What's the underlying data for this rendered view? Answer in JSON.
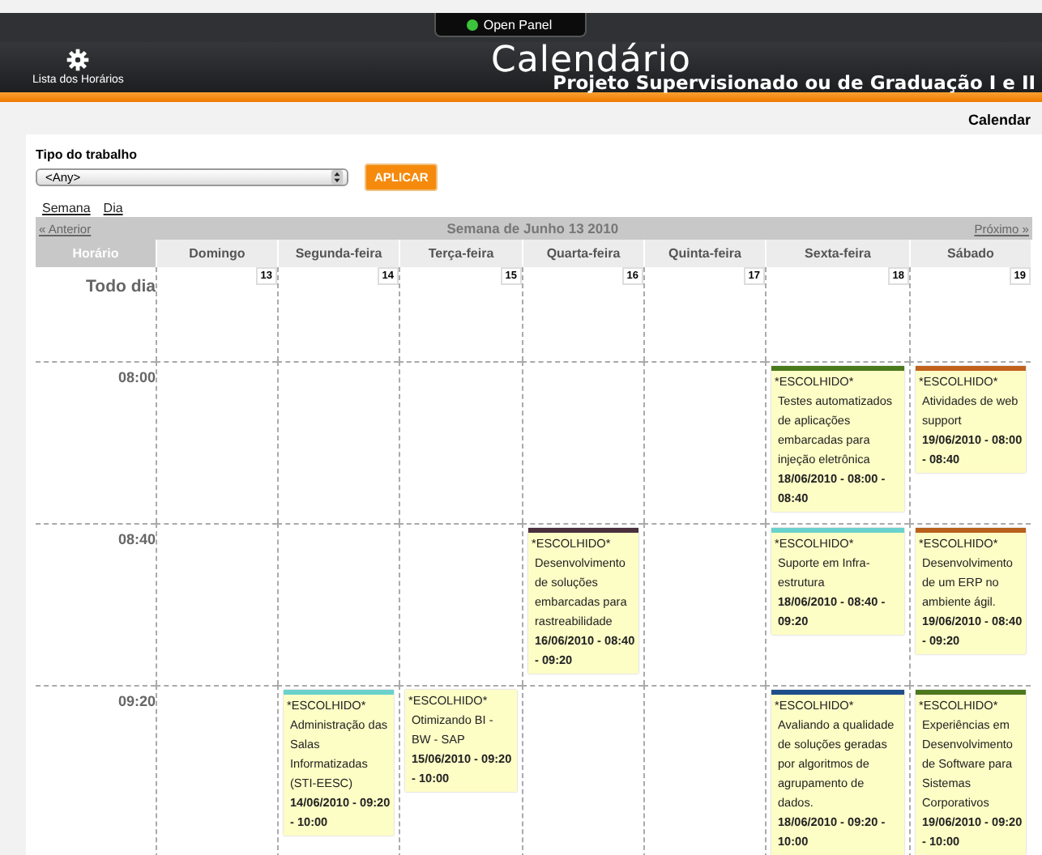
{
  "top_bar": {
    "panel_button": "Open Panel"
  },
  "header": {
    "nav_link": "Lista dos Horários",
    "title": "Calendário",
    "subtitle": "Projeto Supervisionado ou de Graduação I e II"
  },
  "breadcrumb": "Calendar",
  "filter": {
    "label": "Tipo do trabalho",
    "value": "<Any>",
    "button": "APLICAR"
  },
  "views": [
    {
      "label": "Semana"
    },
    {
      "label": "Dia"
    }
  ],
  "week_nav": {
    "previous": "« Anterior",
    "title": "Semana de Junho 13 2010",
    "next": "Próximo »"
  },
  "time_header": "Horário",
  "days": [
    {
      "label": "Domingo",
      "date": "13"
    },
    {
      "label": "Segunda-feira",
      "date": "14"
    },
    {
      "label": "Terça-feira",
      "date": "15"
    },
    {
      "label": "Quarta-feira",
      "date": "16"
    },
    {
      "label": "Quinta-feira",
      "date": "17"
    },
    {
      "label": "Sexta-feira",
      "date": "18"
    },
    {
      "label": "Sábado",
      "date": "19"
    }
  ],
  "all_day_label": "Todo dia",
  "rows": [
    {
      "time": "08:00",
      "cells": [
        {},
        {},
        {},
        {},
        {},
        {
          "tag": "*ESCOLHIDO*",
          "title": "Testes automatizados de aplicações embarcadas para injeção eletrônica",
          "date": "18/06/2010 - 08:00 - 08:40",
          "color": "#4a7a1c"
        },
        {
          "tag": "*ESCOLHIDO*",
          "title": "Atividades de web support",
          "date": "19/06/2010 - 08:00 - 08:40",
          "color": "#c0621c"
        }
      ]
    },
    {
      "time": "08:40",
      "cells": [
        {},
        {},
        {},
        {
          "tag": "*ESCOLHIDO*",
          "title": "Desenvolvimento de soluções embarcadas para rastreabilidade",
          "date": "16/06/2010 - 08:40 - 09:20",
          "color": "#4a2f3c"
        },
        {},
        {
          "tag": "*ESCOLHIDO*",
          "title": "Suporte em Infra-estrutura",
          "date": "18/06/2010 - 08:40 - 09:20",
          "color": "#6ad2cc"
        },
        {
          "tag": "*ESCOLHIDO*",
          "title": "Desenvolvimento de um ERP no ambiente ágil.",
          "date": "19/06/2010 - 08:40 - 09:20",
          "color": "#b8601c"
        }
      ]
    },
    {
      "time": "09:20",
      "cells": [
        {},
        {
          "tag": "*ESCOLHIDO*",
          "title": "Administração das Salas Informatizadas (STI-EESC)",
          "date": "14/06/2010 - 09:20 - 10:00",
          "color": "#6ad2cc"
        },
        {
          "tag": "*ESCOLHIDO*",
          "title": "Otimizando BI - BW - SAP",
          "date": "15/06/2010 - 09:20 - 10:00"
        },
        {},
        {},
        {
          "tag": "*ESCOLHIDO*",
          "title": "Avaliando a qualidade de soluções geradas por algoritmos de agrupamento de dados.",
          "date": "18/06/2010 - 09:20 - 10:00",
          "color": "#1e4e8a"
        },
        {
          "tag": "*ESCOLHIDO*",
          "title": "Experiências em Desenvolvimento de Software para Sistemas Corporativos",
          "date": "19/06/2010 - 09:20 - 10:00",
          "color": "#4e781e"
        }
      ]
    }
  ]
}
